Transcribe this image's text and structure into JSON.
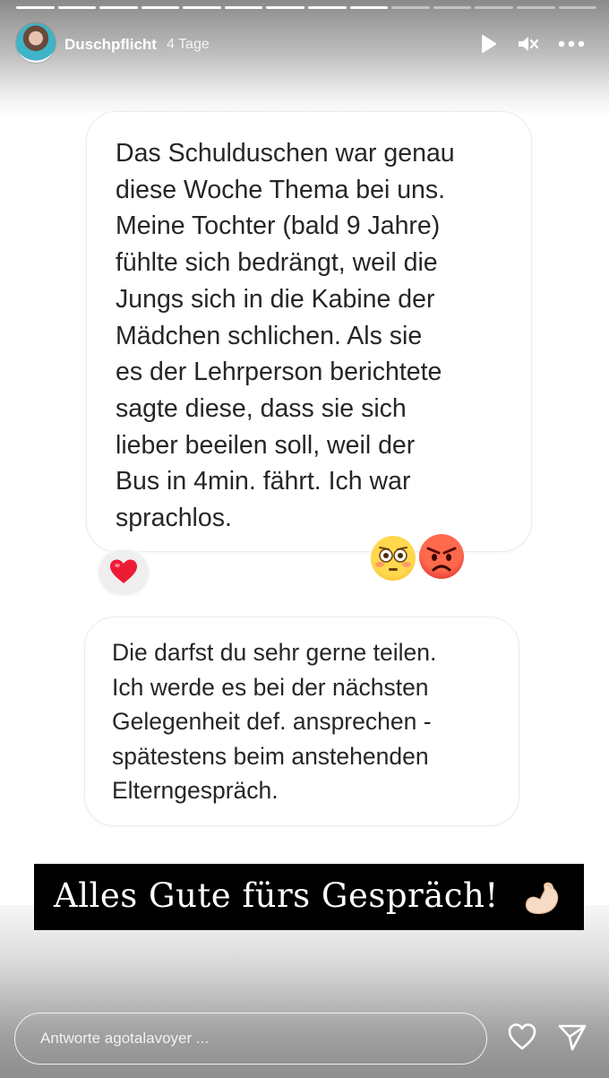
{
  "story": {
    "username": "Duschpflicht",
    "time": "4 Tage",
    "progress": {
      "segments": 14,
      "current": 9
    }
  },
  "bubbles": [
    {
      "text": "Das Schulduschen war genau\ndiese Woche Thema bei uns.\nMeine Tochter (bald 9 Jahre)\nfühlte sich bedrängt, weil die\nJungs sich in die Kabine der\nMädchen schlichen. Als sie\nes der Lehrperson berichtete\nsagte diese, dass sie sich\nlieber beeilen soll, weil der\nBus in 4min. fährt. Ich war\nsprachlos."
    },
    {
      "text": "Die darfst du sehr gerne teilen.\nIch werde es bei der nächsten\nGelegenheit def. ansprechen -\nspätestens beim anstehenden\nElterngespräch."
    }
  ],
  "reaction": "❤️",
  "sticker_emojis": [
    "flushed-face",
    "angry-face"
  ],
  "banner": {
    "text": "Alles Gute fürs Gespräch!",
    "icon": "flexed-biceps"
  },
  "reply": {
    "placeholder": "Antworte agotalavoyer ..."
  },
  "colors": {
    "accent": "#ffffff",
    "text": "#262626",
    "heart": "#ed1c36",
    "banner_bg": "#000000"
  }
}
